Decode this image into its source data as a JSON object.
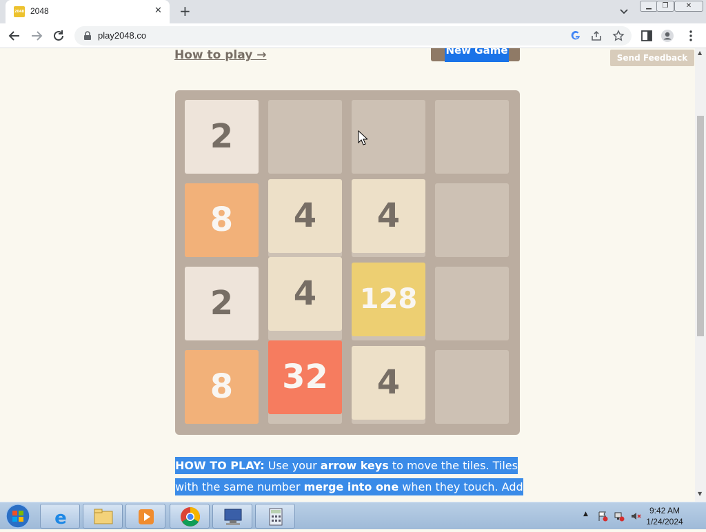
{
  "browser": {
    "tab": {
      "title": "2048",
      "favicon_text": "2048"
    },
    "url": "play2048.co"
  },
  "page": {
    "how_to_play_link": "How to play →",
    "new_game_label": "New Game",
    "feedback_label": "Send Feedback"
  },
  "board": {
    "rows": [
      [
        2,
        null,
        null,
        null
      ],
      [
        8,
        4,
        4,
        null
      ],
      [
        2,
        4,
        128,
        null
      ],
      [
        8,
        32,
        4,
        null
      ]
    ],
    "tile_colors": {
      "2": "#eee4da",
      "4": "#ede0c8",
      "8": "#f2b179",
      "32": "#f67c5f",
      "128": "#edcf72"
    }
  },
  "instructions": {
    "lead": "HOW TO PLAY:",
    "t1": " Use your ",
    "b1": "arrow keys",
    "t2": " to move the tiles. Tiles",
    "t3": "with the same number ",
    "b2": "merge into one",
    "t4": " when they touch. Add"
  },
  "taskbar": {
    "apps": [
      "internet-explorer",
      "file-explorer",
      "media-player",
      "chrome",
      "remote-desktop",
      "calculator"
    ],
    "time": "9:42 AM",
    "date": "1/24/2024"
  }
}
